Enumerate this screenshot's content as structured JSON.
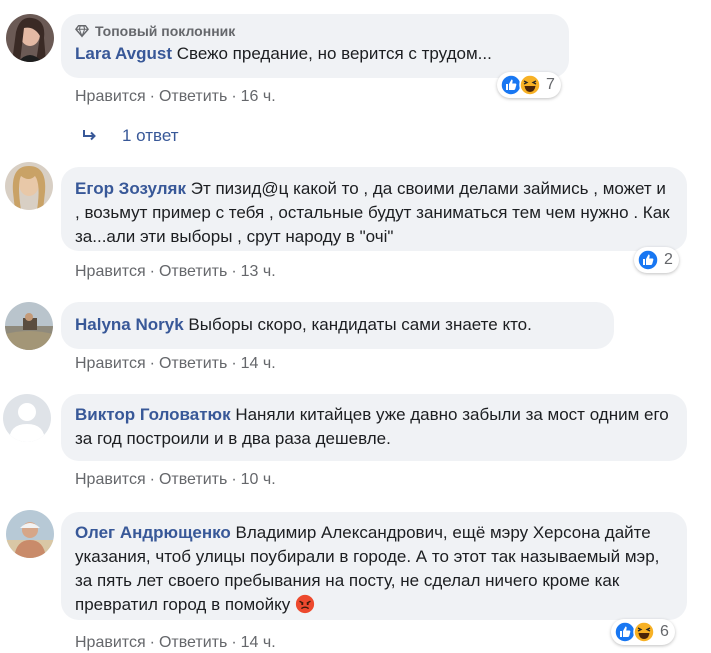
{
  "comments": [
    {
      "badge": "Топовый поклонник",
      "author": "Lara Avgust",
      "text": "Свежо предание, но верится с трудом...",
      "like_label": "Нравится",
      "reply_label": "Ответить",
      "time": "16 ч.",
      "reactions": [
        "like",
        "haha"
      ],
      "reaction_count": "7"
    },
    {
      "author": "Егор Зозуляк",
      "text": "Эт пизид@ц какой то , да своими делами займись , может и , возьмут пример с тебя , остальные будут заниматься тем чем нужно . Как за...али эти выборы , срут народу в \"очі\"",
      "like_label": "Нравится",
      "reply_label": "Ответить",
      "time": "13 ч.",
      "reactions": [
        "like"
      ],
      "reaction_count": "2"
    },
    {
      "author": "Halyna Noryk",
      "text": "Выборы скоро, кандидаты сами знаете кто.",
      "like_label": "Нравится",
      "reply_label": "Ответить",
      "time": "14 ч."
    },
    {
      "author": "Виктор Головатюк",
      "text": "Наняли китайцев уже давно забыли за мост одним его за год построили и в два раза дешевле.",
      "like_label": "Нравится",
      "reply_label": "Ответить",
      "time": "10 ч."
    },
    {
      "author": "Олег Андрющенко",
      "text": "Владимир Александрович, ещё мэру Херсона дайте указания, чтоб улицы поубирали в городе. А то этот так называемый мэр, за пять лет своего пребывания на посту, не сделал ничего кроме как превратил город в помойку",
      "like_label": "Нравится",
      "reply_label": "Ответить",
      "time": "14 ч.",
      "reactions": [
        "like",
        "haha",
        "angry"
      ],
      "reaction_count": "6"
    }
  ],
  "replies_link": "1 ответ",
  "colors": {
    "author": "#385898",
    "bubble": "#f0f2f5",
    "meta": "#65676b",
    "like_blue": "#1877f2",
    "haha_yellow": "#f7b125",
    "angry_red": "#e9710f"
  }
}
